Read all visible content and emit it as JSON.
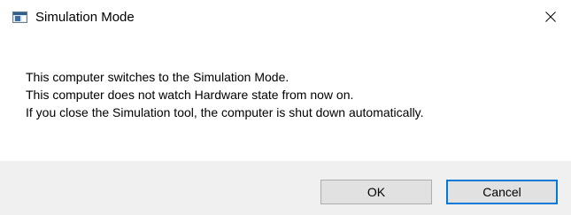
{
  "window": {
    "title": "Simulation Mode",
    "icon": "application-window-icon",
    "close_icon": "close-icon"
  },
  "message": {
    "lines": [
      "This computer switches to the Simulation Mode.",
      "This computer does not watch Hardware state from now on.",
      "If you close the Simulation tool, the computer is shut down automatically."
    ]
  },
  "buttons": {
    "ok_label": "OK",
    "cancel_label": "Cancel"
  },
  "colors": {
    "footer_background": "#f0f0f0",
    "button_background": "#e1e1e1",
    "focus_border": "#0078d7"
  }
}
